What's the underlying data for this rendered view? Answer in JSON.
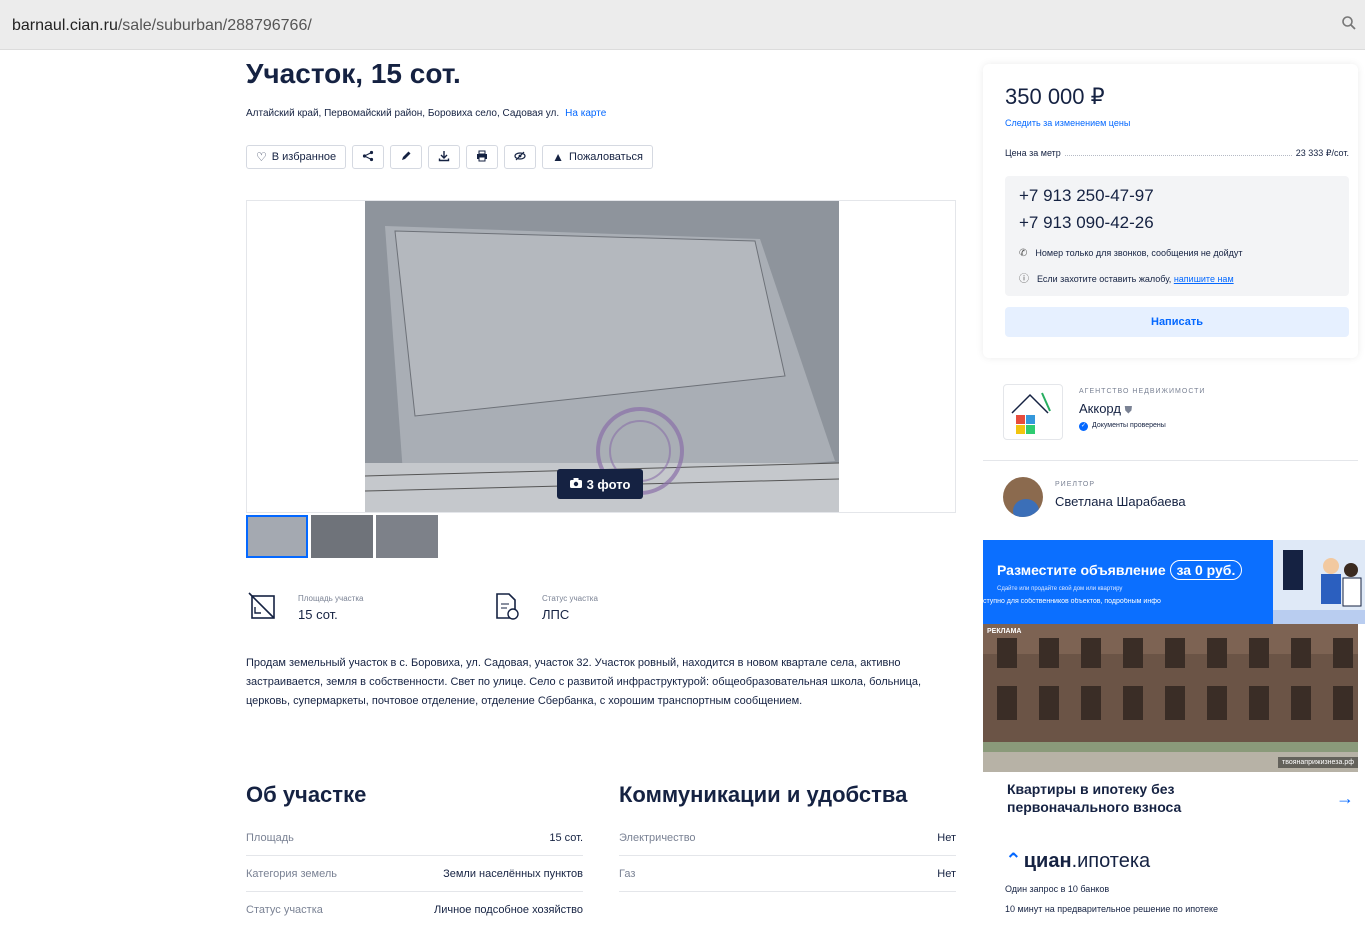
{
  "browser": {
    "url_host": "barnaul.cian.ru",
    "url_path": "/sale/suburban/288796766/"
  },
  "listing": {
    "title": "Участок, 15 сот.",
    "address": "Алтайский край, Первомайский район, Боровиха село, Садовая ул.",
    "map_link": "На карте",
    "actions": {
      "favorite": "В избранное",
      "share_icon": "share-icon",
      "edit_icon": "pencil-icon",
      "download_icon": "download-icon",
      "print_icon": "print-icon",
      "hide_icon": "hide-icon",
      "complain": "Пожаловаться"
    },
    "photo_count": "3 фото",
    "facts": [
      {
        "label": "Площадь участка",
        "value": "15 сот."
      },
      {
        "label": "Статус участка",
        "value": "ЛПС"
      }
    ],
    "description": "Продам земельный участок в с. Боровиха, ул. Садовая, участок 32. Участок ровный, находится в новом квартале села, активно застраивается, земля в собственности. Свет по улице. Село с развитой инфраструктурой: общеобразовательная школа, больница, церковь, супермаркеты, почтовое отделение, отделение Сбербанка, с хорошим транспортным сообщением.",
    "about": {
      "title": "Об участке",
      "rows": [
        {
          "key": "Площадь",
          "value": "15 сот."
        },
        {
          "key": "Категория земель",
          "value": "Земли населённых пунктов"
        },
        {
          "key": "Статус участка",
          "value": "Личное подсобное хозяйство"
        }
      ]
    },
    "utilities": {
      "title": "Коммуникации и удобства",
      "rows": [
        {
          "key": "Электричество",
          "value": "Нет"
        },
        {
          "key": "Газ",
          "value": "Нет"
        }
      ]
    }
  },
  "sidebar": {
    "price": "350 000 ₽",
    "follow_price": "Следить за изменением цены",
    "price_per_unit_label": "Цена за метр",
    "price_per_unit_value": "23 333 ₽/сот.",
    "phones": [
      "+7 913 250-47-97",
      "+7 913 090-42-26"
    ],
    "note_calls": "Номер только для звонков, сообщения не дойдут",
    "note_complaint": "Если захотите оставить жалобу,",
    "note_complaint_link": "напишите нам",
    "write_button": "Написать",
    "agency": {
      "type": "АГЕНТСТВО НЕДВИЖИМОСТИ",
      "name": "Аккорд",
      "verified": "Документы проверены"
    },
    "realtor": {
      "type": "РИЕЛТОР",
      "name": "Светлана Шарабаева"
    },
    "ad1": {
      "title": "Разместите объявление",
      "pill": "за 0 руб.",
      "subtitle": "Сдайте или продайте свой дом или квартиру",
      "ticker": "ступно для собственников объектов, подробным инфо"
    },
    "ad2": {
      "label": "РЕКЛАМА",
      "source": "твоянаприжизнеза.рф",
      "title": "Квартиры в ипотеку без первоначального взноса"
    },
    "cian_mortgage": {
      "logo_a": "циан",
      "logo_b": ".ипотека",
      "line1": "Один запрос в 10 банков",
      "line2": "10 минут на предварительное решение по ипотеке"
    }
  }
}
